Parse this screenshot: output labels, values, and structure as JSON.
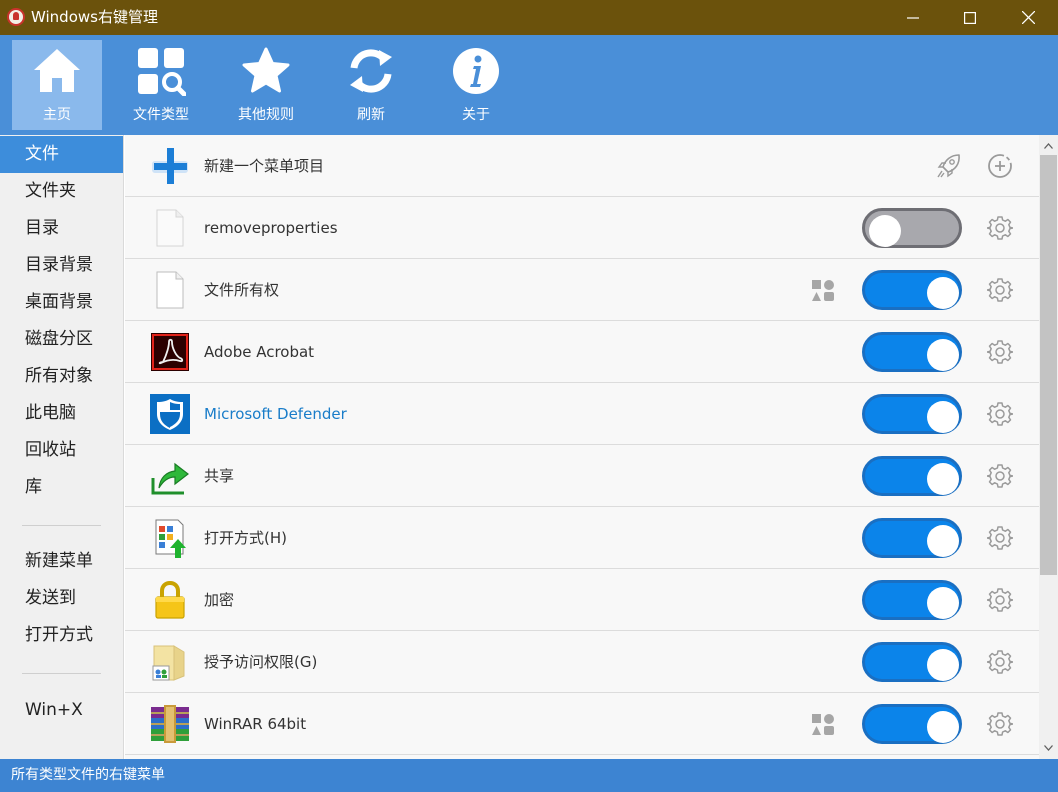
{
  "window": {
    "title": "Windows右键管理",
    "icon": "app-logo-icon",
    "controls": [
      "minimize-icon",
      "maximize-icon",
      "close-icon"
    ]
  },
  "toolbar": {
    "items": [
      {
        "label": "主页",
        "icon": "home-icon",
        "active": true
      },
      {
        "label": "文件类型",
        "icon": "file-types-icon",
        "active": false
      },
      {
        "label": "其他规则",
        "icon": "star-icon",
        "active": false
      },
      {
        "label": "刷新",
        "icon": "refresh-icon",
        "active": false
      },
      {
        "label": "关于",
        "icon": "info-icon",
        "active": false
      }
    ]
  },
  "sidebar": {
    "items": [
      {
        "label": "文件",
        "active": true
      },
      {
        "label": "文件夹"
      },
      {
        "label": "目录"
      },
      {
        "label": "目录背景"
      },
      {
        "label": "桌面背景"
      },
      {
        "label": "磁盘分区"
      },
      {
        "label": "所有对象"
      },
      {
        "label": "此电脑"
      },
      {
        "label": "回收站"
      },
      {
        "label": "库"
      },
      {
        "label": "新建菜单"
      },
      {
        "label": "发送到"
      },
      {
        "label": "打开方式"
      },
      {
        "label": "Win+X"
      }
    ]
  },
  "list": {
    "new_item_label": "新建一个菜单项目",
    "new_item_icons": [
      "rocket-icon",
      "add-circle-icon"
    ],
    "rows": [
      {
        "label": "removeproperties",
        "icon": "blank-file-icon",
        "enabled": false
      },
      {
        "label": "文件所有权",
        "icon": "blank-file-icon",
        "enabled": true,
        "shapes": true
      },
      {
        "label": "Adobe Acrobat",
        "icon": "adobe-acrobat-icon",
        "enabled": true
      },
      {
        "label": "Microsoft Defender",
        "icon": "defender-shield-icon",
        "enabled": true,
        "link": true
      },
      {
        "label": "共享",
        "icon": "share-arrow-icon",
        "enabled": true
      },
      {
        "label": "打开方式(H)",
        "icon": "open-with-icon",
        "enabled": true
      },
      {
        "label": "加密",
        "icon": "lock-icon",
        "enabled": true
      },
      {
        "label": "授予访问权限(G)",
        "icon": "grant-access-icon",
        "enabled": true
      },
      {
        "label": "WinRAR 64bit",
        "icon": "winrar-icon",
        "enabled": true,
        "shapes": true
      }
    ]
  },
  "status": {
    "text": "所有类型文件的右键菜单"
  },
  "colors": {
    "titlebar": "#6b520c",
    "toolbar": "#4a8fd8",
    "accent": "#0b84ea",
    "statusbar": "#3d84d2"
  }
}
